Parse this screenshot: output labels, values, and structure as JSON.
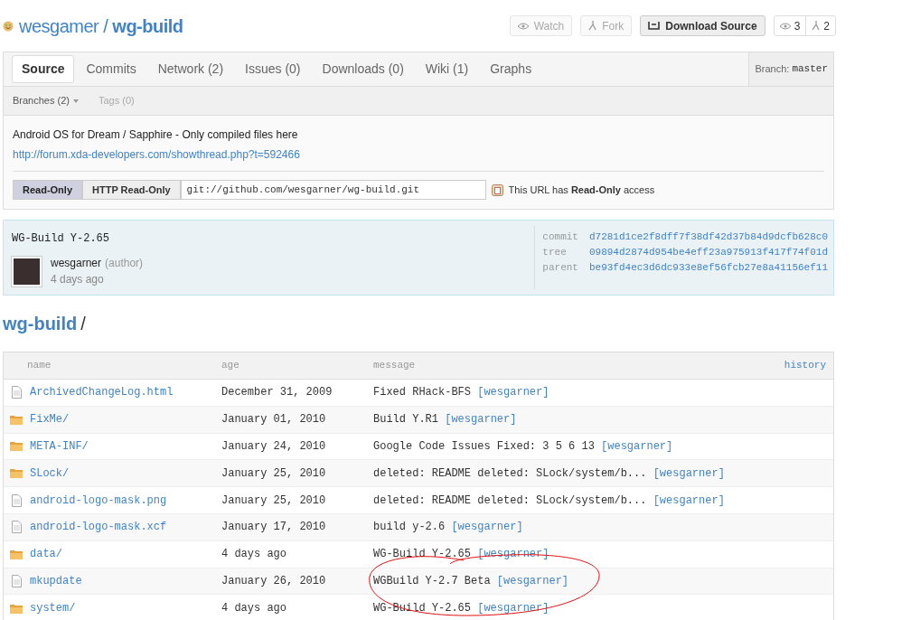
{
  "repo": {
    "owner": "wesgamer",
    "separator": "/",
    "name": "wg-build"
  },
  "actions": [
    {
      "kind": "watch",
      "label": "Watch"
    },
    {
      "kind": "fork",
      "label": "Fork"
    },
    {
      "kind": "download",
      "label": "Download Source"
    }
  ],
  "counters": [
    {
      "kind": "watchers",
      "value": "3"
    },
    {
      "kind": "forks",
      "value": "2"
    }
  ],
  "tabs": [
    {
      "label": "Source",
      "selected": true
    },
    {
      "label": "Commits",
      "selected": false
    },
    {
      "label": "Network (2)",
      "selected": false
    },
    {
      "label": "Issues (0)",
      "selected": false
    },
    {
      "label": "Downloads (0)",
      "selected": false
    },
    {
      "label": "Wiki (1)",
      "selected": false
    },
    {
      "label": "Graphs",
      "selected": false
    }
  ],
  "branch": {
    "label": "Branch:",
    "value": "master"
  },
  "subtabs": [
    {
      "label": "Branches (2)",
      "caret": true,
      "disabled": false
    },
    {
      "label": "Tags (0)",
      "caret": false,
      "disabled": true
    }
  ],
  "description": "Android OS for Dream / Sapphire - Only compiled files here",
  "homepage": "http://forum.xda-developers.com/showthread.php?t=592466",
  "clone": {
    "buttons": [
      {
        "label": "Read-Only",
        "selected": true
      },
      {
        "label": "HTTP Read-Only",
        "selected": false
      }
    ],
    "url": "git://github.com/wesgarner/wg-build.git",
    "note": "This URL has **Read-Only** access"
  },
  "commit": {
    "message": "WG-Build Y-2.65",
    "author": "wesgarner",
    "role": "(author)",
    "date": "4 days ago",
    "meta": [
      {
        "label": "commit",
        "value": "d7281d1ce2f8dff7f38df42d37b84d9dcfb628c0"
      },
      {
        "label": "tree",
        "value": "09894d2874d954be4eff23a975913f417f74f01d"
      },
      {
        "label": "parent",
        "value": "be93fd4ec3d6dc933e8ef56fcb27e8a41156ef11"
      }
    ]
  },
  "breadcrumb": {
    "name": "wg-build",
    "separator": "/"
  },
  "table": {
    "columns": [
      "name",
      "age",
      "message"
    ],
    "history": "history",
    "rows": [
      {
        "kind": "file",
        "name": "ArchivedChangeLog.html",
        "age": "December 31, 2009",
        "message": "Fixed RHack-BFS",
        "author": "[wesgarner]"
      },
      {
        "kind": "folder",
        "name": "FixMe/",
        "age": "January 01, 2010",
        "message": "Build Y.R1",
        "author": "[wesgarner]"
      },
      {
        "kind": "folder",
        "name": "META-INF/",
        "age": "January 24, 2010",
        "message": "Google Code Issues Fixed: 3 5 6 13",
        "author": "[wesgarner]"
      },
      {
        "kind": "folder",
        "name": "SLock/",
        "age": "January 25, 2010",
        "message": "deleted: README deleted: SLock/system/b...",
        "author": "[wesgarner]"
      },
      {
        "kind": "file",
        "name": "android-logo-mask.png",
        "age": "January 25, 2010",
        "message": "deleted: README deleted: SLock/system/b...",
        "author": "[wesgarner]"
      },
      {
        "kind": "file",
        "name": "android-logo-mask.xcf",
        "age": "January 17, 2010",
        "message": "build y-2.6",
        "author": "[wesgarner]"
      },
      {
        "kind": "folder",
        "name": "data/",
        "age": "4 days ago",
        "message": "WG-Build Y-2.65",
        "author": "[wesgarner]"
      },
      {
        "kind": "file",
        "name": "mkupdate",
        "age": "January 26, 2010",
        "message": "WGBuild Y-2.7 Beta",
        "author": "[wesgarner]"
      },
      {
        "kind": "folder",
        "name": "system/",
        "age": "4 days ago",
        "message": "WG-Build Y-2.65",
        "author": "[wesgarner]"
      }
    ]
  }
}
